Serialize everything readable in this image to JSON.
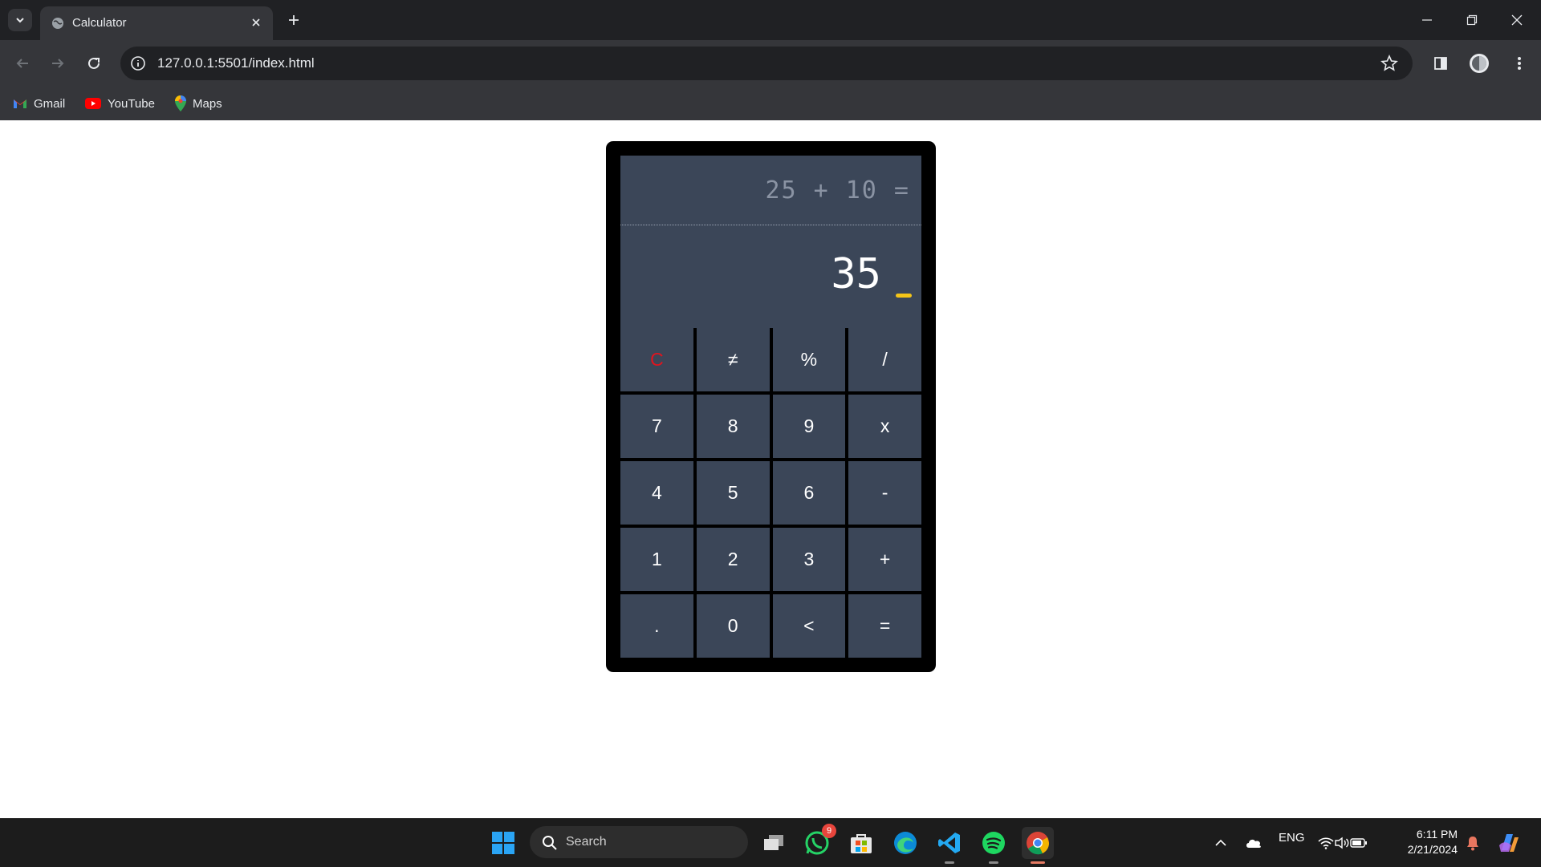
{
  "browser": {
    "tab_title": "Calculator",
    "url": "127.0.0.1:5501/index.html",
    "bookmarks": [
      {
        "label": "Gmail",
        "icon": "gmail-icon"
      },
      {
        "label": "YouTube",
        "icon": "youtube-icon"
      },
      {
        "label": "Maps",
        "icon": "maps-icon"
      }
    ]
  },
  "calculator": {
    "previous": "25 + 10 =",
    "current": "35",
    "keys": [
      "C",
      "≠",
      "%",
      "/",
      "7",
      "8",
      "9",
      "x",
      "4",
      "5",
      "6",
      "-",
      "1",
      "2",
      "3",
      "+",
      ".",
      "0",
      "<",
      "="
    ],
    "accent_color": "#f5c518",
    "clear_color": "#e0141e"
  },
  "taskbar": {
    "search_label": "Search",
    "whatsapp_badge": "9",
    "language": "ENG",
    "time": "6:11 PM",
    "date": "2/21/2024"
  }
}
